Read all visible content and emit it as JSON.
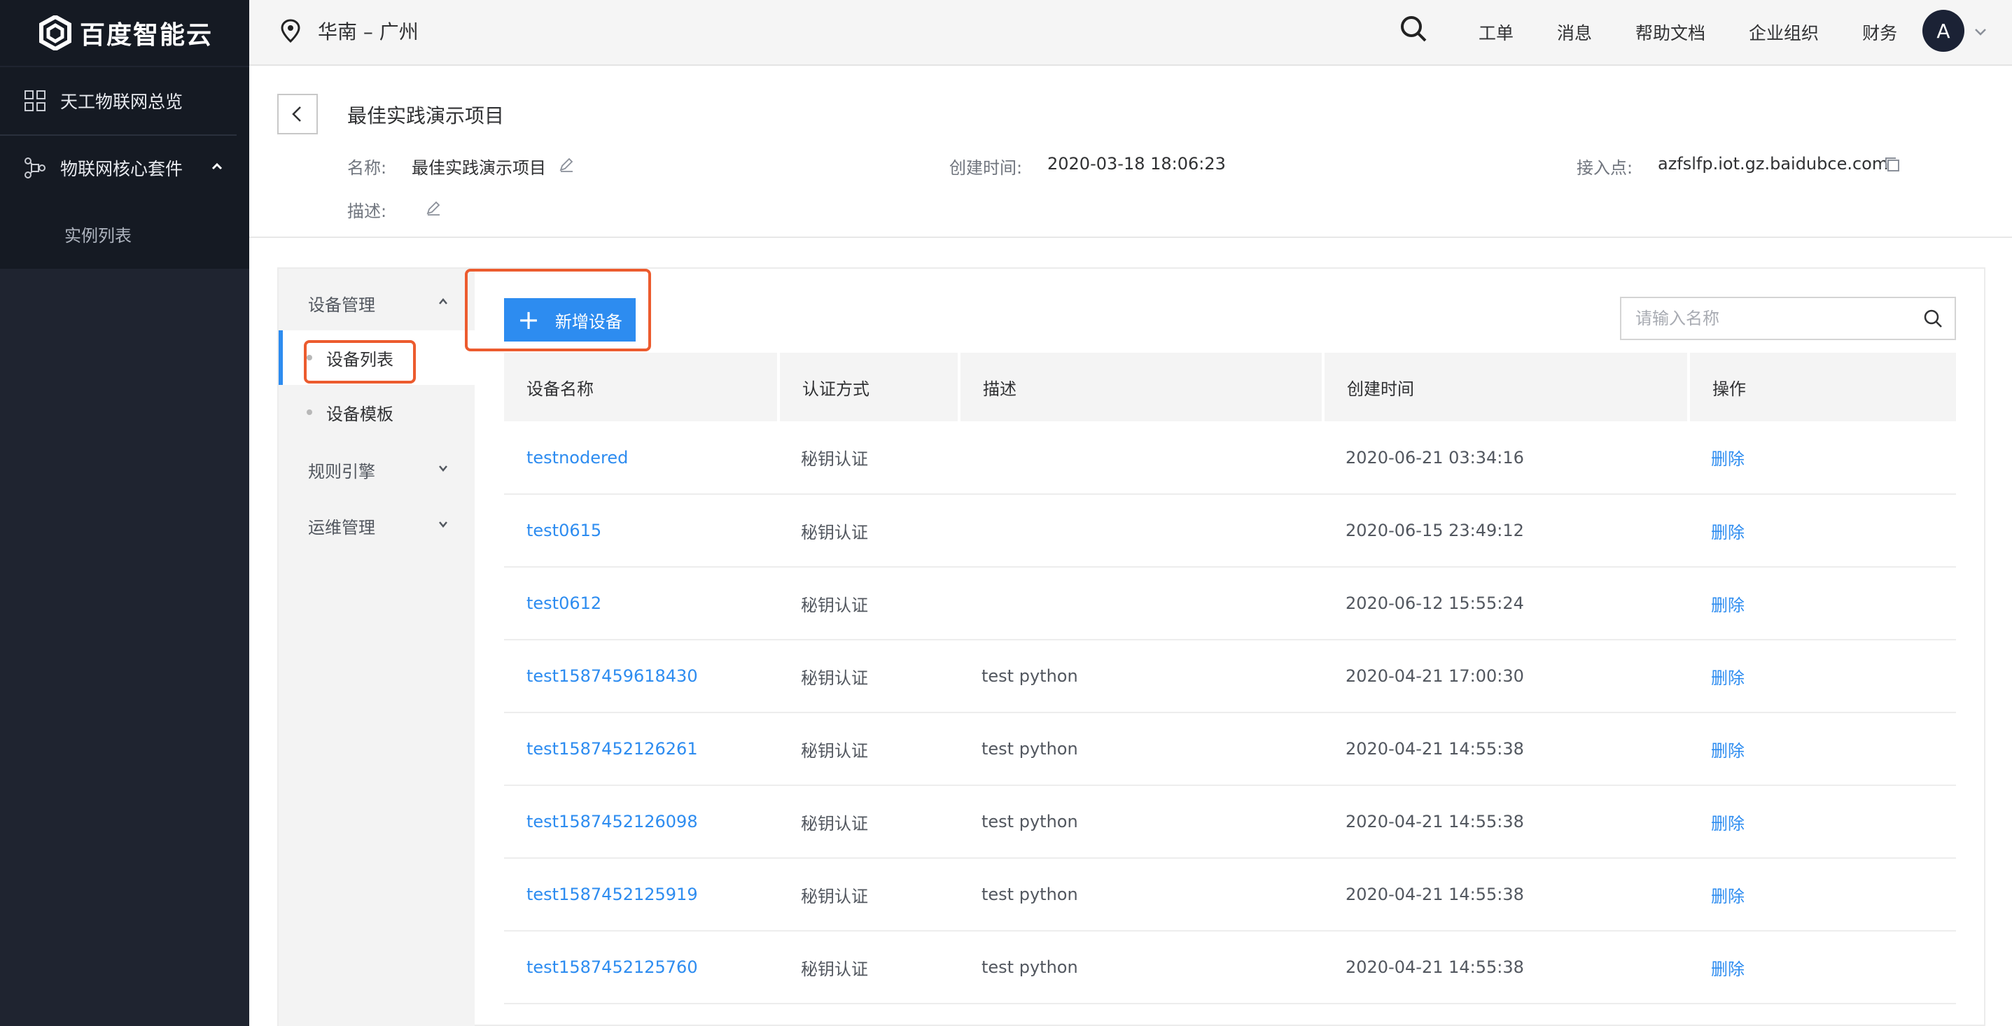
{
  "brand": {
    "name": "百度智能云"
  },
  "sidebar": {
    "items": [
      {
        "label": "天工物联网总览",
        "icon": "grid-icon"
      },
      {
        "label": "物联网核心套件",
        "icon": "hub-icon",
        "expanded": true
      }
    ],
    "sub_items": [
      {
        "label": "实例列表"
      }
    ]
  },
  "topbar": {
    "region": "华南 – 广州",
    "menu": [
      "工单",
      "消息",
      "帮助文档",
      "企业组织",
      "财务"
    ],
    "avatar_letter": "A"
  },
  "project": {
    "title": "最佳实践演示项目",
    "name_label": "名称:",
    "name_value": "最佳实践演示项目",
    "created_label": "创建时间:",
    "created_value": "2020-03-18 18:06:23",
    "endpoint_label": "接入点:",
    "endpoint_value": "azfslfp.iot.gz.baidubce.com",
    "desc_label": "描述:"
  },
  "subnav": {
    "group_device": "设备管理",
    "items": [
      {
        "label": "设备列表",
        "active": true
      },
      {
        "label": "设备模板",
        "active": false
      }
    ],
    "group_rules": "规则引擎",
    "group_ops": "运维管理"
  },
  "toolbar": {
    "add_label": "新增设备",
    "search_placeholder": "请输入名称"
  },
  "table": {
    "columns": [
      "设备名称",
      "认证方式",
      "描述",
      "创建时间",
      "操作"
    ],
    "rows": [
      {
        "name": "testnodered",
        "auth": "秘钥认证",
        "desc": "",
        "created": "2020-06-21 03:34:16",
        "op": "删除"
      },
      {
        "name": "test0615",
        "auth": "秘钥认证",
        "desc": "",
        "created": "2020-06-15 23:49:12",
        "op": "删除"
      },
      {
        "name": "test0612",
        "auth": "秘钥认证",
        "desc": "",
        "created": "2020-06-12 15:55:24",
        "op": "删除"
      },
      {
        "name": "test1587459618430",
        "auth": "秘钥认证",
        "desc": "test python",
        "created": "2020-04-21 17:00:30",
        "op": "删除"
      },
      {
        "name": "test1587452126261",
        "auth": "秘钥认证",
        "desc": "test python",
        "created": "2020-04-21 14:55:38",
        "op": "删除"
      },
      {
        "name": "test1587452126098",
        "auth": "秘钥认证",
        "desc": "test python",
        "created": "2020-04-21 14:55:38",
        "op": "删除"
      },
      {
        "name": "test1587452125919",
        "auth": "秘钥认证",
        "desc": "test python",
        "created": "2020-04-21 14:55:38",
        "op": "删除"
      },
      {
        "name": "test1587452125760",
        "auth": "秘钥认证",
        "desc": "test python",
        "created": "2020-04-21 14:55:38",
        "op": "删除"
      }
    ]
  },
  "colors": {
    "primary": "#2d8cf0",
    "highlight": "#ec5b2e",
    "sidebar_bg": "#1f2430"
  }
}
